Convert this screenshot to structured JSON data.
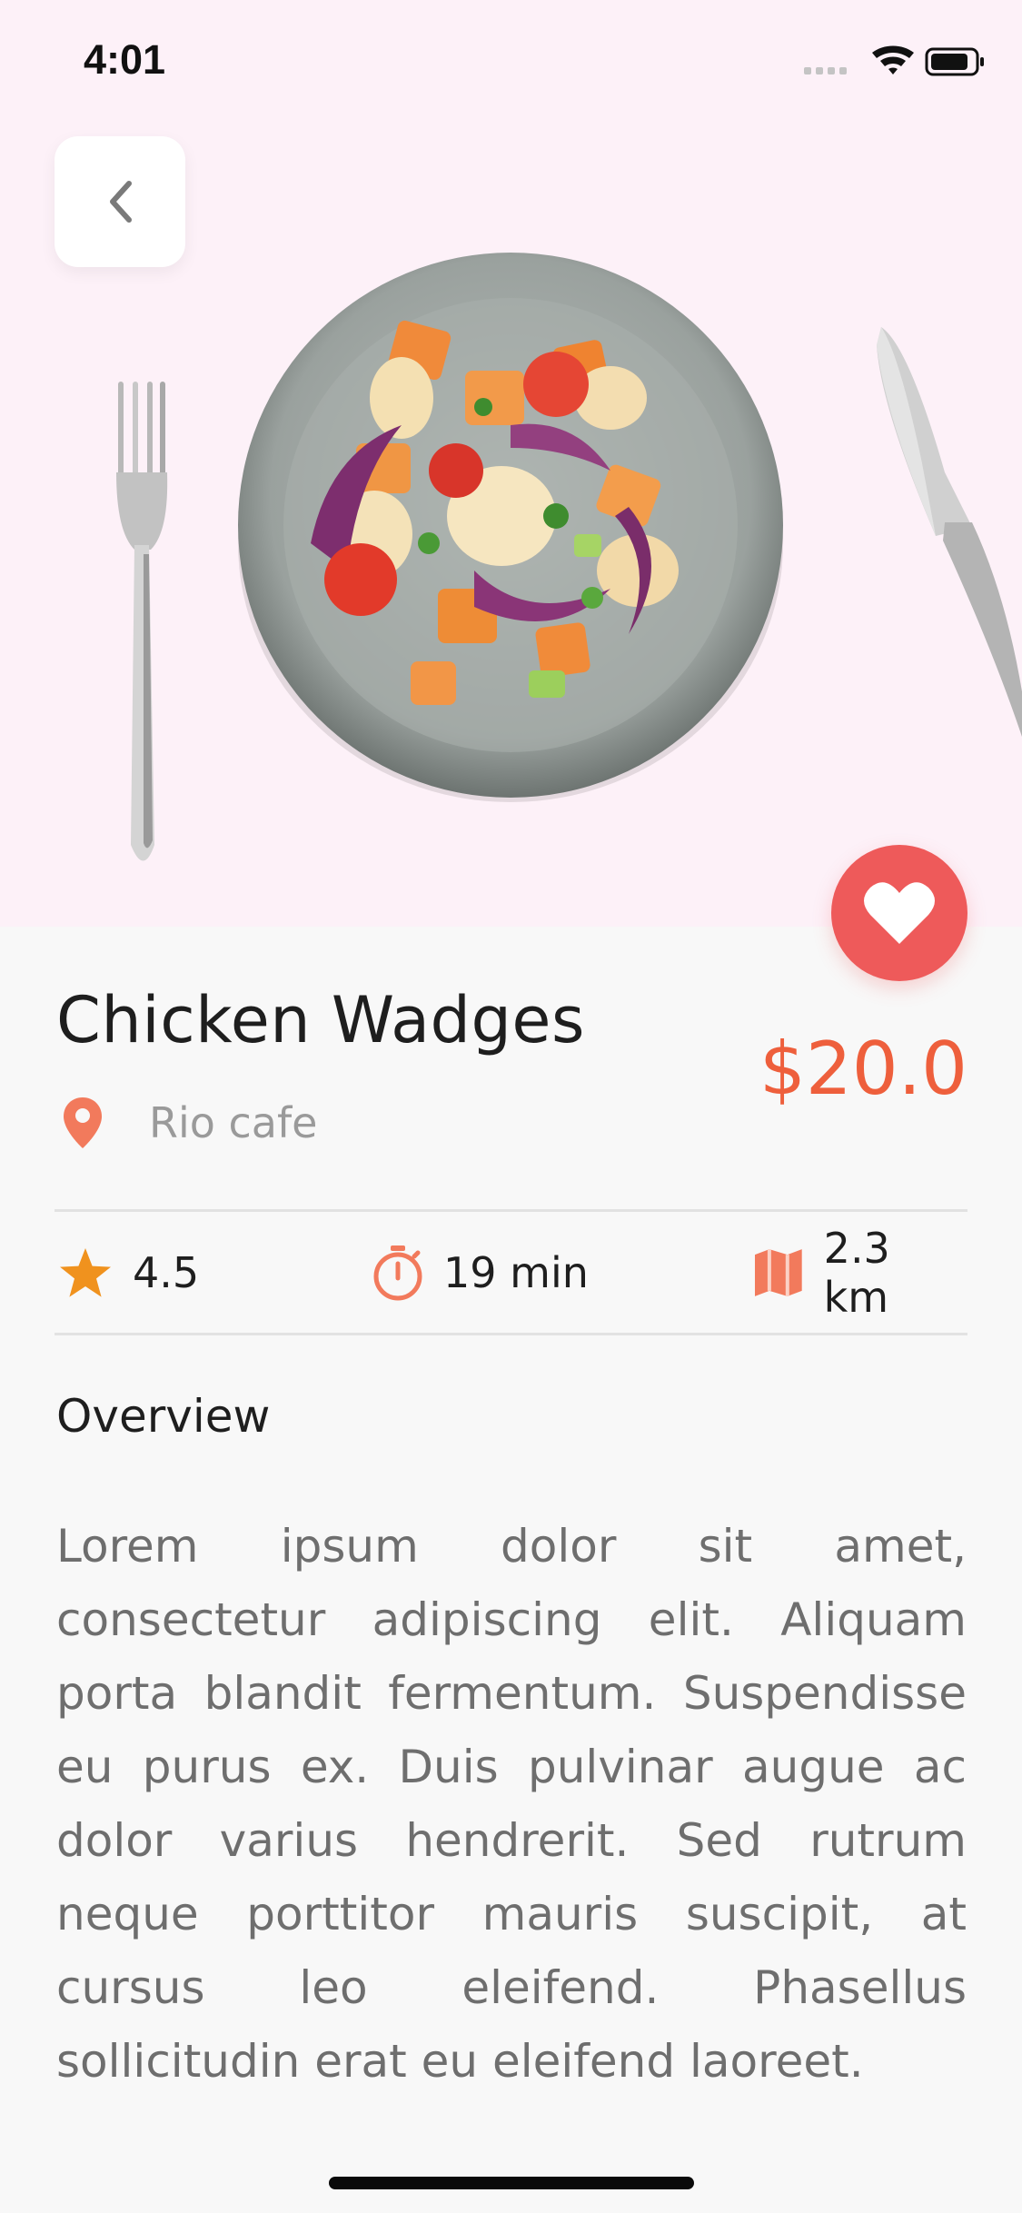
{
  "status_bar": {
    "time": "4:01"
  },
  "dish": {
    "name": "Chicken Wadges",
    "price": "$20.0",
    "restaurant": "Rio cafe"
  },
  "stats": {
    "rating": "4.5",
    "time": "19 min",
    "distance": "2.3 km"
  },
  "overview": {
    "label": "Overview",
    "text": "Lorem ipsum dolor sit amet, consectetur adipiscing elit. Aliquam porta blandit fermentum. Suspendisse eu purus ex. Duis pulvinar augue ac dolor varius hendrerit. Sed rutrum neque porttitor mauris suscipit, at cursus leo eleifend. Phasellus sollicitudin erat eu eleifend laoreet."
  },
  "colors": {
    "accent": "#ee5f3c",
    "favorite": "#ee5a5a",
    "star": "#f0921e",
    "hero_bg": "#fdf1f8"
  },
  "icons": {
    "back": "chevron-left-icon",
    "favorite": "heart-icon",
    "location": "location-pin-icon",
    "rating": "star-icon",
    "time": "stopwatch-icon",
    "distance": "map-icon"
  }
}
